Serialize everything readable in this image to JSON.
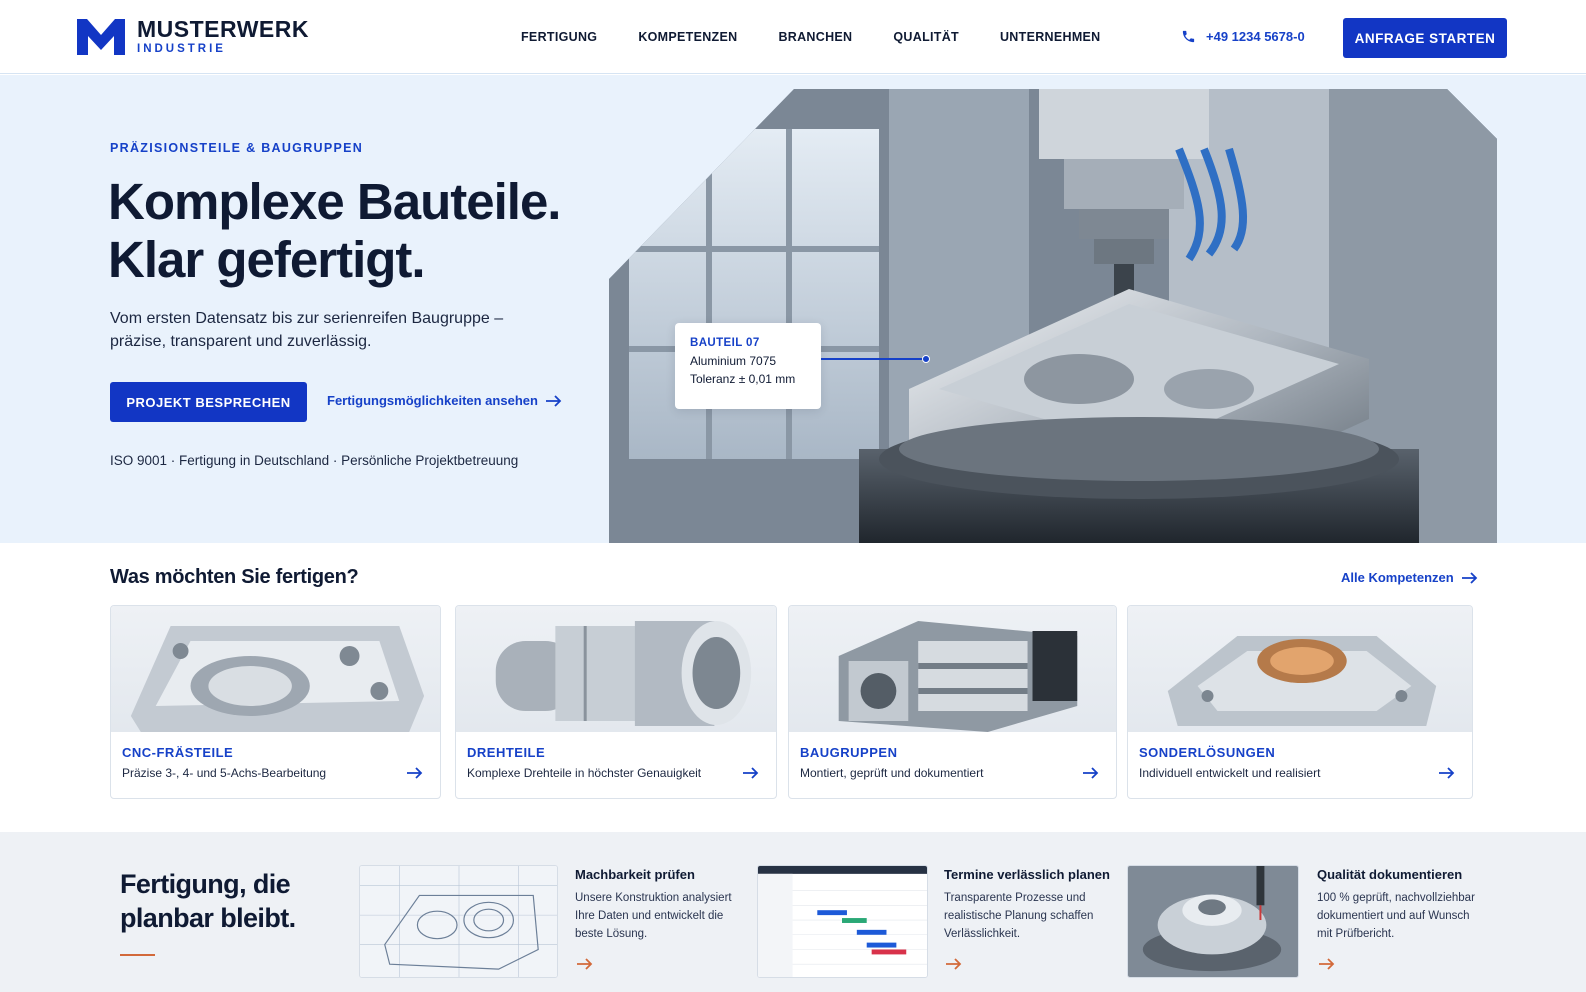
{
  "colors": {
    "primary": "#1236c4",
    "accent": "#d2693a",
    "hero_bg": "#e9f2fc",
    "ink": "#0f1a33"
  },
  "header": {
    "logo_name": "MUSTERWERK",
    "logo_sub": "INDUSTRIE",
    "nav": [
      "FERTIGUNG",
      "KOMPETENZEN",
      "BRANCHEN",
      "QUALITÄT",
      "UNTERNEHMEN"
    ],
    "phone": "+49 1234 5678-0",
    "phone_icon": "phone-icon",
    "cta": "ANFRAGE STARTEN"
  },
  "hero": {
    "eyebrow": "PRÄZISIONSTEILE & BAUGRUPPEN",
    "title_line1": "Komplexe Bauteile.",
    "title_line2": "Klar gefertigt.",
    "lead": "Vom ersten Datensatz bis zur serienreifen Baugruppe – präzise, transparent und zuverlässig.",
    "primary_button": "PROJEKT BESPRECHEN",
    "secondary_link": "Fertigungsmöglichkeiten ansehen",
    "trust_line": "ISO 9001 · Fertigung in Deutschland · Persönliche Projektbetreuung",
    "callout": {
      "title": "BAUTEIL 07",
      "material": "Aluminium 7075",
      "tolerance": "Toleranz ± 0,01 mm"
    }
  },
  "services": {
    "title": "Was möchten Sie fertigen?",
    "all_link": "Alle Kompetenzen",
    "cards": [
      {
        "title": "CNC-FRÄSTEILE",
        "desc": "Präzise 3-, 4- und 5-Achs-Bearbeitung"
      },
      {
        "title": "DREHTEILE",
        "desc": "Komplexe Drehteile in höchster Genauigkeit"
      },
      {
        "title": "BAUGRUPPEN",
        "desc": "Montiert, geprüft und dokumentiert"
      },
      {
        "title": "SONDERLÖSUNGEN",
        "desc": "Individuell entwickelt und realisiert"
      }
    ]
  },
  "process": {
    "title_line1": "Fertigung, die",
    "title_line2": "planbar bleibt.",
    "features": [
      {
        "title": "Machbarkeit prüfen",
        "text": "Unsere Konstruktion analysiert Ihre Daten und entwickelt die beste Lösung."
      },
      {
        "title": "Termine verlässlich planen",
        "text": "Transparente Prozesse und realistische Planung schaffen Verlässlichkeit."
      },
      {
        "title": "Qualität dokumentieren",
        "text": "100 % geprüft, nachvollziehbar dokumentiert und auf Wunsch mit Prüfbericht."
      }
    ]
  }
}
